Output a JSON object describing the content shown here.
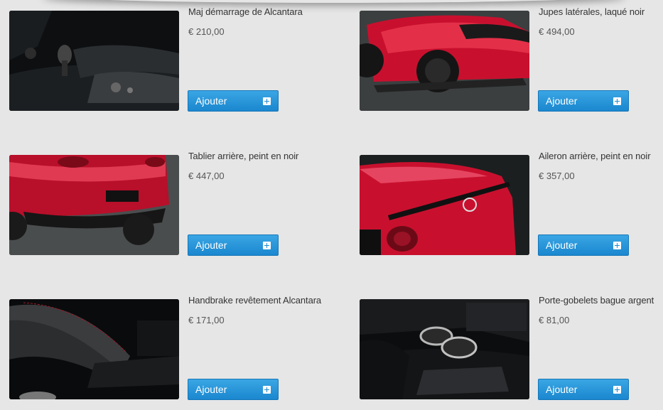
{
  "accent_color": "#2a96da",
  "button_label": "Ajouter",
  "products": [
    {
      "title": "Maj démarrage de Alcantara",
      "price": "€ 210,00",
      "image": "interior-shifter-photo"
    },
    {
      "title": "Jupes latérales, laqué noir",
      "price": "€ 494,00",
      "image": "red-car-side-skirt-photo"
    },
    {
      "title": "Tablier arrière, peint en noir",
      "price": "€ 447,00",
      "image": "red-car-rear-apron-photo"
    },
    {
      "title": "Aileron arrière, peint en noir",
      "price": "€ 357,00",
      "image": "red-car-rear-spoiler-photo"
    },
    {
      "title": "Handbrake revêtement Alcantara",
      "price": "€ 171,00",
      "image": "handbrake-cover-photo"
    },
    {
      "title": "Porte-gobelets bague argent",
      "price": "€ 81,00",
      "image": "cup-holder-photo"
    }
  ]
}
